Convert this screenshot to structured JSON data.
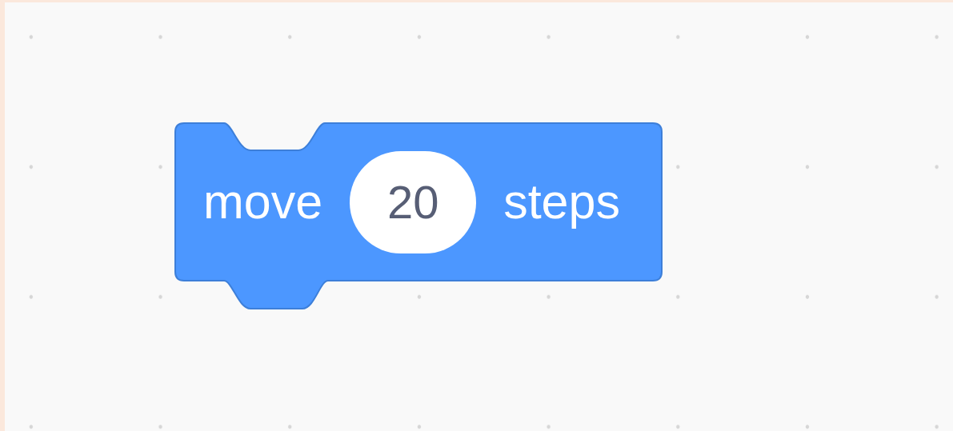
{
  "block": {
    "kind": "motion",
    "parts": [
      {
        "kind": "label",
        "text": "move"
      },
      {
        "kind": "number",
        "value": "20"
      },
      {
        "kind": "label",
        "text": "steps"
      }
    ]
  }
}
